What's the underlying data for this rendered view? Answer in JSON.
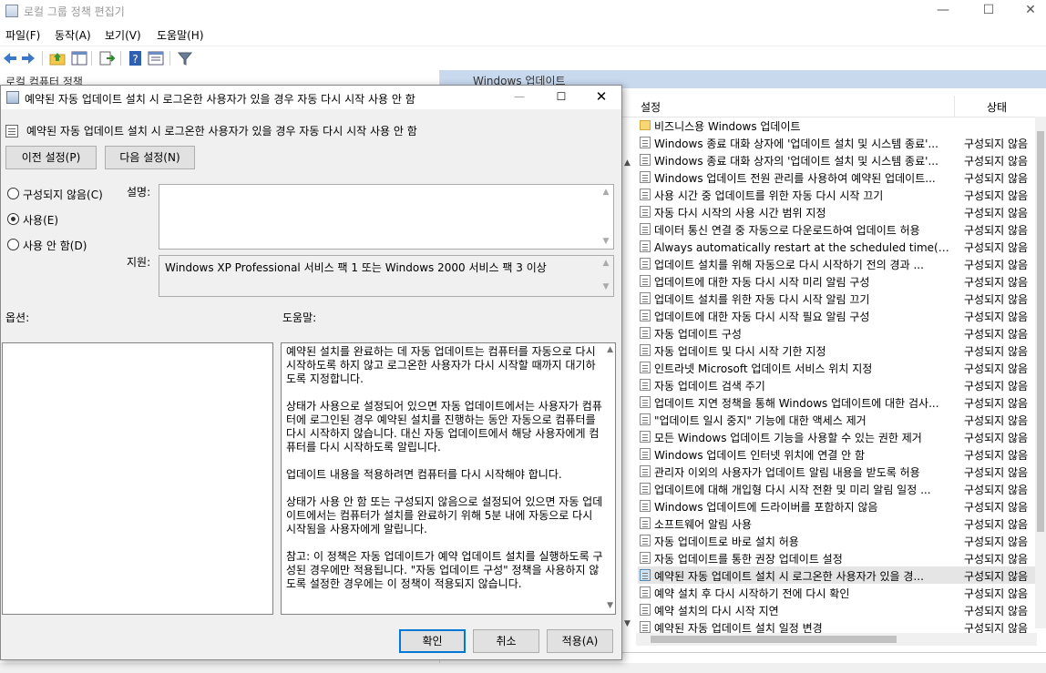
{
  "app": {
    "title": "로컬 그룹 정책 편집기",
    "minimize_glyph": "—",
    "maximize_glyph": "☐",
    "close_glyph": "✕"
  },
  "menu": [
    "파일(F)",
    "동작(A)",
    "보기(V)",
    "도움말(H)"
  ],
  "toolbar": {
    "icons": [
      "back-arrow-icon",
      "forward-arrow-icon",
      "up-folder-icon",
      "show-hide-tree-icon",
      "export-list-icon",
      "help-icon",
      "properties-icon",
      "filter-icon"
    ]
  },
  "tree": {
    "root_label": "로컬 컴퓨터 정책"
  },
  "right_pane": {
    "header": "Windows 업데이트",
    "col_setting": "설정",
    "col_state": "상태",
    "rows": [
      {
        "name": "비즈니스용 Windows 업데이트",
        "state": "",
        "folder": true,
        "selected": false
      },
      {
        "name": "Windows 종료 대화 상자에 '업데이트 설치 및 시스템 종료'...",
        "state": "구성되지 않음",
        "folder": false,
        "selected": false
      },
      {
        "name": "Windows 종료 대화 상자의 '업데이트 설치 및 시스템 종료'...",
        "state": "구성되지 않음",
        "folder": false,
        "selected": false
      },
      {
        "name": "Windows 업데이트 전원 관리를 사용하여 예약된 업데이트...",
        "state": "구성되지 않음",
        "folder": false,
        "selected": false
      },
      {
        "name": "사용 시간 중 업데이트를 위한 자동 다시 시작 끄기",
        "state": "구성되지 않음",
        "folder": false,
        "selected": false
      },
      {
        "name": "자동 다시 시작의 사용 시간 범위 지정",
        "state": "구성되지 않음",
        "folder": false,
        "selected": false
      },
      {
        "name": "데이터 통신 연결 중 자동으로 다운로드하여 업데이트 허용",
        "state": "구성되지 않음",
        "folder": false,
        "selected": false
      },
      {
        "name": "Always automatically restart at the scheduled time(항상 예...",
        "state": "구성되지 않음",
        "folder": false,
        "selected": false
      },
      {
        "name": "업데이트 설치를 위해 자동으로 다시 시작하기 전의 경과 ...",
        "state": "구성되지 않음",
        "folder": false,
        "selected": false
      },
      {
        "name": "업데이트에 대한 자동 다시 시작 미리 알림 구성",
        "state": "구성되지 않음",
        "folder": false,
        "selected": false
      },
      {
        "name": "업데이트 설치를 위한 자동 다시 시작 알림 끄기",
        "state": "구성되지 않음",
        "folder": false,
        "selected": false
      },
      {
        "name": "업데이트에 대한 자동 다시 시작 필요 알림 구성",
        "state": "구성되지 않음",
        "folder": false,
        "selected": false
      },
      {
        "name": "자동 업데이트 구성",
        "state": "구성되지 않음",
        "folder": false,
        "selected": false
      },
      {
        "name": "자동 업데이트 및 다시 시작 기한 지정",
        "state": "구성되지 않음",
        "folder": false,
        "selected": false
      },
      {
        "name": "인트라넷 Microsoft 업데이트 서비스 위치 지정",
        "state": "구성되지 않음",
        "folder": false,
        "selected": false
      },
      {
        "name": "자동 업데이트 검색 주기",
        "state": "구성되지 않음",
        "folder": false,
        "selected": false
      },
      {
        "name": "업데이트 지연 정책을 통해 Windows 업데이트에 대한 검사...",
        "state": "구성되지 않음",
        "folder": false,
        "selected": false
      },
      {
        "name": "\"업데이트 일시 중지\" 기능에 대한 액세스 제거",
        "state": "구성되지 않음",
        "folder": false,
        "selected": false
      },
      {
        "name": "모든 Windows 업데이트 기능을 사용할 수 있는 권한 제거",
        "state": "구성되지 않음",
        "folder": false,
        "selected": false
      },
      {
        "name": "Windows 업데이트 인터넷 위치에 연결 안 함",
        "state": "구성되지 않음",
        "folder": false,
        "selected": false
      },
      {
        "name": "관리자 이외의 사용자가 업데이트 알림 내용을 받도록 허용",
        "state": "구성되지 않음",
        "folder": false,
        "selected": false
      },
      {
        "name": "업데이트에 대해 개입형 다시 시작 전환 및 미리 알림 일정 ...",
        "state": "구성되지 않음",
        "folder": false,
        "selected": false
      },
      {
        "name": "Windows 업데이트에 드라이버를 포함하지 않음",
        "state": "구성되지 않음",
        "folder": false,
        "selected": false
      },
      {
        "name": "소프트웨어 알림 사용",
        "state": "구성되지 않음",
        "folder": false,
        "selected": false
      },
      {
        "name": "자동 업데이트로 바로 설치 허용",
        "state": "구성되지 않음",
        "folder": false,
        "selected": false
      },
      {
        "name": "자동 업데이트를 통한 권장 업데이트 설정",
        "state": "구성되지 않음",
        "folder": false,
        "selected": false
      },
      {
        "name": "예약된 자동 업데이트 설치 시 로그온한 사용자가 있을 경...",
        "state": "구성되지 않음",
        "folder": false,
        "selected": true
      },
      {
        "name": "예약 설치 후 다시 시작하기 전에 다시 확인",
        "state": "구성되지 않음",
        "folder": false,
        "selected": false
      },
      {
        "name": "예약 설치의 다시 시작 지연",
        "state": "구성되지 않음",
        "folder": false,
        "selected": false
      },
      {
        "name": "예약된 자동 업데이트 설치 일정 변경",
        "state": "구성되지 않음",
        "folder": false,
        "selected": false
      }
    ]
  },
  "dialog": {
    "title": "예약된 자동 업데이트 설치 시 로그온한 사용자가 있을 경우 자동 다시 시작 사용 안 함",
    "header": "예약된 자동 업데이트 설치 시 로그온한 사용자가 있을 경우 자동 다시 시작 사용 안 함",
    "prev_button": "이전 설정(P)",
    "next_button": "다음 설정(N)",
    "radio_not_configured": "구성되지 않음(C)",
    "radio_enabled": "사용(E)",
    "radio_disabled": "사용 안 함(D)",
    "selected_option": "enabled",
    "comment_label": "설명:",
    "comment_value": "",
    "support_label": "지원:",
    "support_text": "Windows XP Professional 서비스 팩 1 또는 Windows 2000 서비스 팩 3 이상",
    "options_label": "옵션:",
    "help_label": "도움말:",
    "help_paragraphs": [
      "예약된 설치를 완료하는 데 자동 업데이트는 컴퓨터를 자동으로 다시 시작하도록 하지 않고 로그온한 사용자가 다시 시작할 때까지 대기하도록 지정합니다.",
      "상태가 사용으로 설정되어 있으면 자동 업데이트에서는 사용자가 컴퓨터에 로그인된 경우 예약된 설치를 진행하는 동안 자동으로 컴퓨터를 다시 시작하지 않습니다. 대신 자동 업데이트에서 해당 사용자에게 컴퓨터를 다시 시작하도록 알립니다.",
      "업데이트 내용을 적용하려면 컴퓨터를 다시 시작해야 합니다.",
      "상태가 사용 안 함 또는 구성되지 않음으로 설정되어 있으면 자동 업데이트에서는 컴퓨터가 설치를 완료하기 위해 5분 내에 자동으로 다시 시작됨을 사용자에게 알립니다.",
      "참고: 이 정책은 자동 업데이트가 예약 업데이트 설치를 실행하도록 구성된 경우에만 적용됩니다. \"자동 업데이트 구성\" 정책을 사용하지 않도록 설정한 경우에는 이 정책이 적용되지 않습니다."
    ],
    "ok_button": "확인",
    "cancel_button": "취소",
    "apply_button": "적용(A)"
  }
}
